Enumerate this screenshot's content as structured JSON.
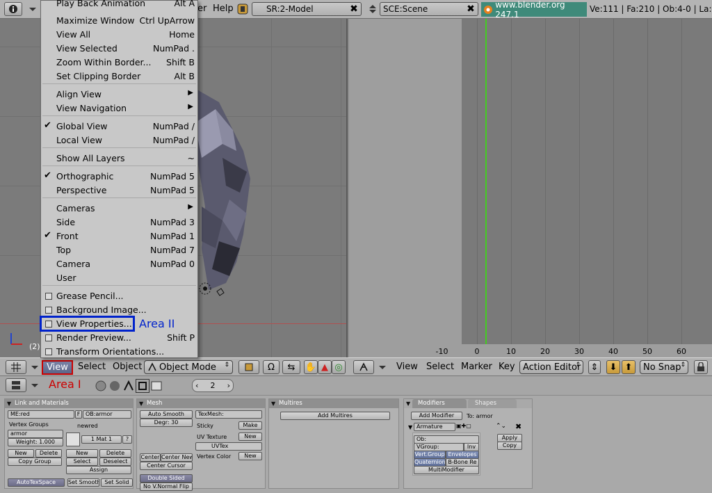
{
  "topbar": {
    "info_icon": "info-icon",
    "help_menu": "Help",
    "screen_field": "SR:2-Model",
    "scene_field": "SCE:Scene",
    "url_text": "www.blender.org 247.1",
    "stats": "Ve:111 | Fa:210 | Ob:4-0 | La:",
    "partial_menu_letter": "er"
  },
  "view_menu": {
    "items": [
      {
        "label": "Play Back Animation",
        "shortcut": "Alt A"
      },
      {
        "label": "Maximize Window",
        "shortcut": "Ctrl UpArrow"
      },
      {
        "label": "View All",
        "shortcut": "Home"
      },
      {
        "label": "View Selected",
        "shortcut": "NumPad ."
      },
      {
        "label": "Zoom Within Border...",
        "shortcut": "Shift B"
      },
      {
        "label": "Set Clipping Border",
        "shortcut": "Alt B"
      },
      {
        "label": "Align View",
        "shortcut": ""
      },
      {
        "label": "View Navigation",
        "shortcut": ""
      },
      {
        "label": "Global View",
        "shortcut": "NumPad /"
      },
      {
        "label": "Local View",
        "shortcut": "NumPad /"
      },
      {
        "label": "Show All Layers",
        "shortcut": "~"
      },
      {
        "label": "Orthographic",
        "shortcut": "NumPad 5"
      },
      {
        "label": "Perspective",
        "shortcut": "NumPad 5"
      },
      {
        "label": "Cameras",
        "shortcut": ""
      },
      {
        "label": "Side",
        "shortcut": "NumPad 3"
      },
      {
        "label": "Front",
        "shortcut": "NumPad 1"
      },
      {
        "label": "Top",
        "shortcut": "NumPad 7"
      },
      {
        "label": "Camera",
        "shortcut": "NumPad 0"
      },
      {
        "label": "User",
        "shortcut": ""
      },
      {
        "label": "Grease Pencil...",
        "shortcut": ""
      },
      {
        "label": "Background Image...",
        "shortcut": ""
      },
      {
        "label": "View Properties...",
        "shortcut": ""
      },
      {
        "label": "Render Preview...",
        "shortcut": "Shift P"
      },
      {
        "label": "Transform Orientations...",
        "shortcut": ""
      }
    ]
  },
  "annotations": {
    "area1": "Area I",
    "area2": "Area II"
  },
  "viewport": {
    "frame_label": "(2)"
  },
  "view3d_header": {
    "view": "View",
    "select": "Select",
    "object": "Object",
    "mode": "Object Mode"
  },
  "action_editor": {
    "ticks": [
      "-10",
      "0",
      "10",
      "20",
      "30",
      "40",
      "50",
      "60"
    ],
    "current_frame": 2,
    "header": {
      "view": "View",
      "select": "Select",
      "marker": "Marker",
      "key": "Key",
      "editor_type": "Action Editor",
      "snap": "No Snap"
    }
  },
  "buttons_header": {
    "frame": "2"
  },
  "buttons": {
    "link_materials": {
      "title": "Link and Materials",
      "me_field": "ME:red",
      "f_label": "F",
      "ob_field": "OB:armor",
      "vertex_groups": "Vertex Groups",
      "newred": "newred",
      "group_name": "armor",
      "weight": "Weight: 1.000",
      "mat_counter": "1 Mat 1",
      "question": "?",
      "new": "New",
      "delete": "Delete",
      "copy_group": "Copy Group",
      "new2": "New",
      "delete2": "Delete",
      "select": "Select",
      "deselect": "Deselect",
      "assign": "Assign",
      "autotexspace": "AutoTexSpace",
      "set_smooth": "Set Smooth",
      "set_solid": "Set Solid"
    },
    "mesh": {
      "title": "Mesh",
      "auto_smooth": "Auto Smooth",
      "degr": "Degr: 30",
      "texmesh": "TexMesh:",
      "sticky": "Sticky",
      "make": "Make",
      "uv_texture": "UV Texture",
      "new": "New",
      "uvtex": "UVTex",
      "vertex_color": "Vertex Color",
      "new2": "New",
      "center": "Center",
      "center_new": "Center New",
      "center_cursor": "Center Cursor",
      "double_sided": "Double Sided",
      "no_vnormal_flip": "No V.Normal Flip"
    },
    "multires": {
      "title": "Multires",
      "add_multires": "Add Multires"
    },
    "modifiers": {
      "tab_modifiers": "Modifiers",
      "tab_shapes": "Shapes",
      "add_modifier": "Add Modifier",
      "to": "To: armor",
      "armature": "Armature",
      "apply": "Apply",
      "copy": "Copy",
      "ob": "Ob:",
      "vgroup": "VGroup:",
      "inv": "Inv",
      "vert_group": "Vert.Group",
      "envelopes": "Envelopes",
      "quaternion": "Quaternion",
      "bbone": "B-Bone Re",
      "multimodifier": "MultiModifier"
    }
  },
  "colors": {
    "area1_box": "#cc0000",
    "area2_box": "#0022cc",
    "current_frame_line": "#44cc22",
    "url_bg": "#3f8a7a"
  }
}
